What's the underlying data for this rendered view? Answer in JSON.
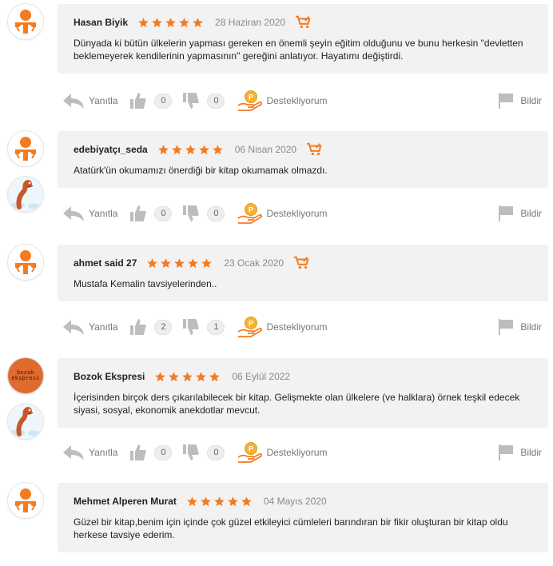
{
  "colors": {
    "accent": "#f47b20",
    "star": "#f47b20",
    "bubble": "#f2f2f2",
    "icon_gray": "#bdbdbd"
  },
  "labels": {
    "reply": "Yanıtla",
    "support": "Destekliyorum",
    "report": "Bildir"
  },
  "reviews": [
    {
      "user": "Hasan Biyik",
      "rating": 5,
      "date": "28 Haziran 2020",
      "text": "Dünyada ki bütün ülkelerin yapması gereken en önemli şeyin eğitim olduğunu ve bunu herkesin \"devletten beklemeyerek kendilerinin yapmasının\" gereğini anlatıyor. Hayatımı değiştirdi.",
      "likes": "0",
      "dislikes": "0",
      "avatars": [
        "default-avatar"
      ]
    },
    {
      "user": "edebiyatçı_seda",
      "rating": 5,
      "date": "06 Nisan 2020",
      "text": "Atatürk'ün okumamızı önerdiği bir kitap okumamak olmazdı.",
      "likes": "0",
      "dislikes": "0",
      "avatars": [
        "default-avatar",
        "worm-avatar"
      ]
    },
    {
      "user": "ahmet said 27",
      "rating": 5,
      "date": "23 Ocak 2020",
      "text": "Mustafa Kemalin tavsiyelerinden..",
      "likes": "2",
      "dislikes": "1",
      "avatars": [
        "default-avatar"
      ]
    },
    {
      "user": "Bozok Ekspresi",
      "rating": 5,
      "date": "06 Eylül 2022",
      "text": "İçerisinden birçok ders çıkarılabilecek bir kitap. Gelişmekte olan ülkelere (ve halklara) örnek teşkil edecek siyasi, sosyal, ekonomik anekdotlar mevcut.",
      "likes": "0",
      "dislikes": "0",
      "avatars": [
        "bozok-avatar",
        "worm-avatar"
      ],
      "avatar_text": "bozok ekspresi"
    },
    {
      "user": "Mehmet Alperen Murat",
      "rating": 5,
      "date": "04 Mayıs 2020",
      "text": "Güzel bir kitap,benim için içinde çok güzel etkileyici cümleleri barındıran bir fikir oluşturan bir kitap oldu herkese tavsiye ederim.",
      "avatars": [
        "default-avatar"
      ]
    }
  ]
}
